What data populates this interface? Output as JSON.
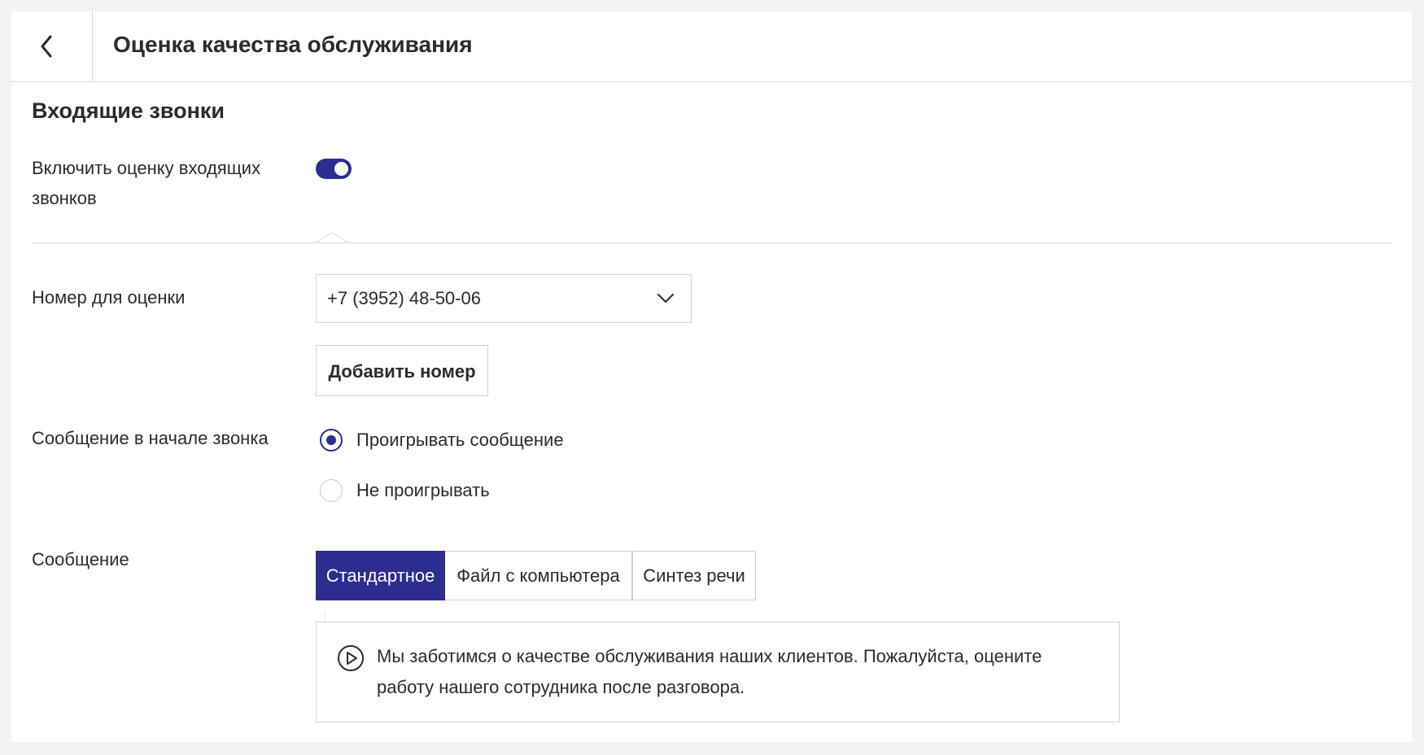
{
  "header": {
    "title": "Оценка качества обслуживания",
    "back_icon": "chevron-left-icon"
  },
  "section": {
    "title": "Входящие звонки"
  },
  "enable_rating": {
    "label": "Включить оценку входящих звонков",
    "enabled": true,
    "accent_color": "#2b2d8f"
  },
  "number": {
    "label": "Номер для оценки",
    "selected": "+7 (3952) 48-50-06",
    "add_button_label": "Добавить номер"
  },
  "start_message": {
    "label": "Сообщение в начале звонка",
    "options": [
      {
        "label": "Проигрывать сообщение",
        "checked": true
      },
      {
        "label": "Не проигрывать",
        "checked": false
      }
    ]
  },
  "message": {
    "label": "Сообщение",
    "tabs": [
      {
        "label": "Стандартное",
        "active": true
      },
      {
        "label": "Файл с компьютера",
        "active": false
      },
      {
        "label": "Синтез речи",
        "active": false
      }
    ],
    "text": "Мы заботимся о качестве обслуживания наших клиентов. Пожалуйста, оцените работу нашего сотрудника после разговора.",
    "play_icon": "play-circle-icon"
  }
}
